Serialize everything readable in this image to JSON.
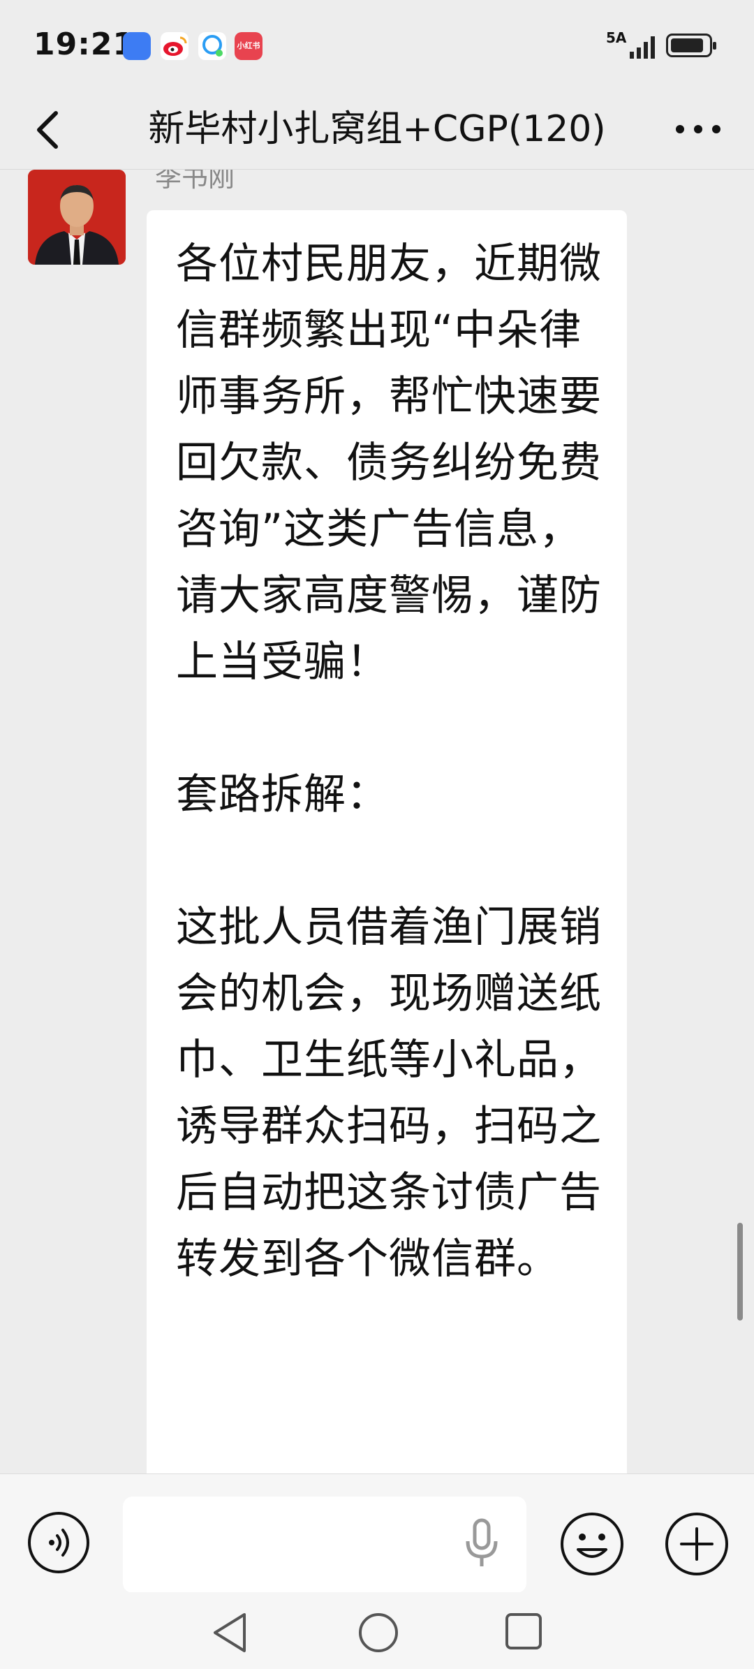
{
  "status_bar": {
    "time": "19:21",
    "network_label": "5A",
    "notification_icons": [
      "message-icon",
      "weibo-icon",
      "qq-icon",
      "xiaohongshu-icon"
    ],
    "xiaohongshu_label": "小红书"
  },
  "header": {
    "title": "新毕村小扎窝组+CGP(120)"
  },
  "message": {
    "sender": "李书刚",
    "text": "各位村民朋友，近期微信群频繁出现“中朵律师事务所，帮忙快速要回欠款、债务纠纷免费咨询”这类广告信息，请大家高度警惕，谨防上当受骗！\n\n套路拆解：\n\n这批人员借着渔门展销会的机会，现场赠送纸巾、卫生纸等小礼品，诱导群众扫码，扫码之后自动把这条讨债广告转发到各个微信群。"
  },
  "input_bar": {
    "value": ""
  },
  "colors": {
    "background": "#ededed",
    "bubble": "#ffffff",
    "accent_red": "#c8261d"
  }
}
